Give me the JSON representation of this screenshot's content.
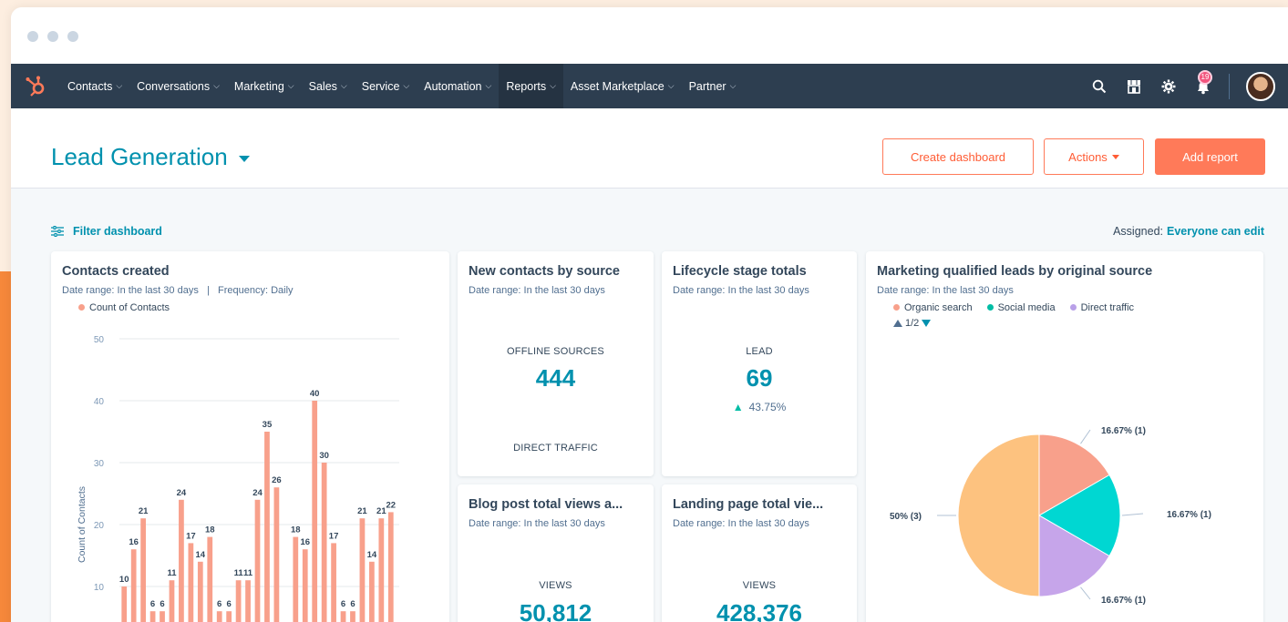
{
  "colors": {
    "accent": "#0091ae",
    "brand": "#ff7a59",
    "nav": "#2d3e50",
    "bar": "#f8a08b"
  },
  "nav": {
    "items": [
      {
        "label": "Contacts"
      },
      {
        "label": "Conversations"
      },
      {
        "label": "Marketing"
      },
      {
        "label": "Sales"
      },
      {
        "label": "Service"
      },
      {
        "label": "Automation"
      },
      {
        "label": "Reports"
      },
      {
        "label": "Asset Marketplace"
      },
      {
        "label": "Partner"
      }
    ],
    "notifications": "19"
  },
  "header": {
    "title": "Lead Generation",
    "create_label": "Create dashboard",
    "actions_label": "Actions",
    "add_label": "Add report"
  },
  "filter": {
    "label": "Filter dashboard",
    "assigned_label": "Assigned:",
    "assigned_value": "Everyone can edit"
  },
  "cards": {
    "contacts": {
      "title": "Contacts created",
      "subtitle": "Date range: In the last 30 days   |   Frequency: Daily",
      "legend": "Count of Contacts"
    },
    "source": {
      "title": "New contacts by source",
      "subtitle": "Date range: In the last 30 days",
      "label1": "OFFLINE SOURCES",
      "value1": "444",
      "label2": "DIRECT TRAFFIC"
    },
    "lifecycle": {
      "title": "Lifecycle stage totals",
      "subtitle": "Date range: In the last 30 days",
      "label": "LEAD",
      "value": "69",
      "change": "43.75%"
    },
    "blog": {
      "title": "Blog post total views a...",
      "subtitle": "Date range: In the last 30 days",
      "label": "VIEWS",
      "value": "50,812"
    },
    "landing": {
      "title": "Landing page total vie...",
      "subtitle": "Date range: In the last 30 days",
      "label": "VIEWS",
      "value": "428,376"
    },
    "mql": {
      "title": "Marketing qualified leads by original source",
      "subtitle": "Date range: In the last 30 days",
      "legend": [
        {
          "name": "Organic search",
          "color": "#f8a08b"
        },
        {
          "name": "Social media",
          "color": "#00bda5"
        },
        {
          "name": "Direct traffic",
          "color": "#b9a0e8"
        }
      ],
      "pager": "1/2"
    }
  },
  "chart_data": [
    {
      "type": "bar",
      "title": "Contacts created",
      "ylabel": "Count of Contacts",
      "ylim": [
        0,
        50
      ],
      "yticks": [
        10,
        20,
        30,
        40,
        50
      ],
      "series": [
        {
          "name": "Count of Contacts",
          "color": "#f8a08b",
          "values": [
            10,
            16,
            21,
            6,
            6,
            11,
            24,
            17,
            14,
            18,
            6,
            6,
            11,
            11,
            24,
            35,
            26,
            null,
            18,
            16,
            40,
            30,
            17,
            6,
            6,
            21,
            14,
            21,
            22
          ]
        }
      ],
      "labels": [
        "10",
        "16",
        "21",
        "6",
        "6",
        "11",
        "24",
        "17",
        "14",
        "18",
        "6",
        "6",
        "11",
        "11",
        "24",
        "35",
        "26",
        "",
        "18",
        "16",
        "40",
        "30",
        "17",
        "6",
        "6",
        "21",
        "14",
        "21",
        "22"
      ]
    },
    {
      "type": "pie",
      "title": "Marketing qualified leads by original source",
      "slices": [
        {
          "label": "16.67% (1)",
          "value": 1,
          "color": "#f8a08b"
        },
        {
          "label": "16.67% (1)",
          "value": 1,
          "color": "#00d7d2"
        },
        {
          "label": "16.67% (1)",
          "value": 1,
          "color": "#c6a5ea"
        },
        {
          "label": "50% (3)",
          "value": 3,
          "color": "#fdc27f"
        }
      ]
    }
  ]
}
